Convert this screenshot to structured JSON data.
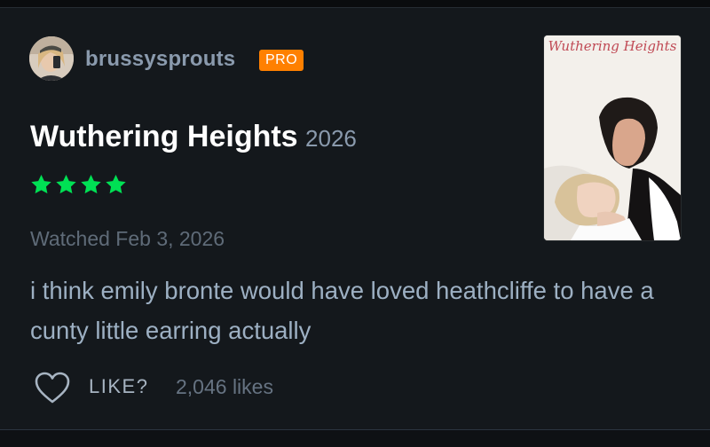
{
  "review": {
    "username": "brussysprouts",
    "badge": "PRO",
    "film_title": "Wuthering Heights",
    "film_year": "2026",
    "rating_stars": 4,
    "rating_icon": "star-icon",
    "watched": "Watched Feb 3, 2026",
    "text": "i think emily bronte would have loved heathcliffe to have a cunty little earring actually",
    "like_label": "LIKE?",
    "likes": "2,046 likes",
    "poster_title": "Wuthering Heights"
  },
  "colors": {
    "background": "#14181c",
    "pro_badge": "#ff8000",
    "stars": "#00e054",
    "title": "#ffffff",
    "muted": "#8a9aad"
  }
}
